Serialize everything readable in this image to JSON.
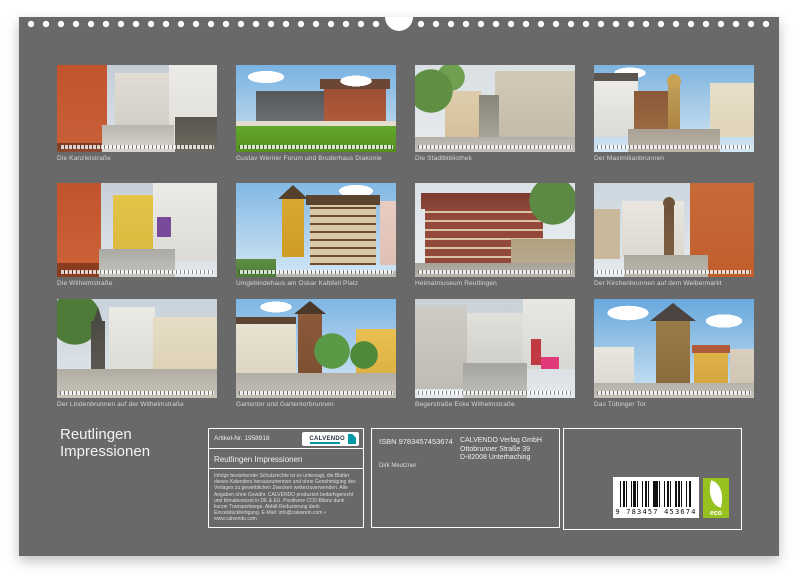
{
  "page": {
    "title_lines": [
      "Reutlingen",
      "Impressionen"
    ]
  },
  "grid": {
    "photos": [
      {
        "caption": "Die Kanzleistraße"
      },
      {
        "caption": "Gustav Werner Forum und Bruderhaus Diakonie"
      },
      {
        "caption": "Die Stadtbibliothek"
      },
      {
        "caption": "Der Maximilianbrunnen"
      },
      {
        "caption": "Die Wilhelmstraße"
      },
      {
        "caption": "Umgebindehaus am Oskar Kalbfell Platz"
      },
      {
        "caption": "Heimatmuseum Reutlingen"
      },
      {
        "caption": "Der Kirchenbrunnen auf dem Weibermarkt"
      },
      {
        "caption": "Der Lindenbrunnen auf der Wilhelmstraße"
      },
      {
        "caption": "Gartentor und Gartentorbrunnen"
      },
      {
        "caption": "Begerstraße Ecke Wilhelmstraße"
      },
      {
        "caption": "Das Tübinger Tor"
      }
    ]
  },
  "info_box": {
    "artikel_nr": "Artikel-Nr. 1958918",
    "logo_text": "CALVENDO",
    "calendar_title": "Reutlingen Impressionen",
    "legal_text": "Infolge bestehender Schutzrechte ist es untersagt, die Blätter dieses Kalenders herauszutrennen und ohne Genehmigung des Verlages zu gewerblichen Zwecken weiterzuverwenden. Alle Angaben ohne Gewähr. CALVENDO produziert bedarfsgerecht und klimabewusst in DE & EU. Positivere CO2-Bilanz dank kurzer Transportwege. Abfall-Reduzierung dank Einzelstückfertigung. E-Mail: info@calvendo.com • www.calvendo.com"
  },
  "publisher_box": {
    "isbn": "ISBN 9783457453674",
    "author": "Dirk Meutzner",
    "address_lines": [
      "CALVENDO Verlag GmbH",
      "Ottobrunner Straße 39",
      "D-82008 Unterhaching"
    ]
  },
  "barcode_box": {
    "digits": "9 783457 453674",
    "eco_label": "eco"
  },
  "colors": {
    "page_gray": "#696969",
    "calvendo_teal": "#0097a7",
    "eco_green": "#97c11f"
  }
}
